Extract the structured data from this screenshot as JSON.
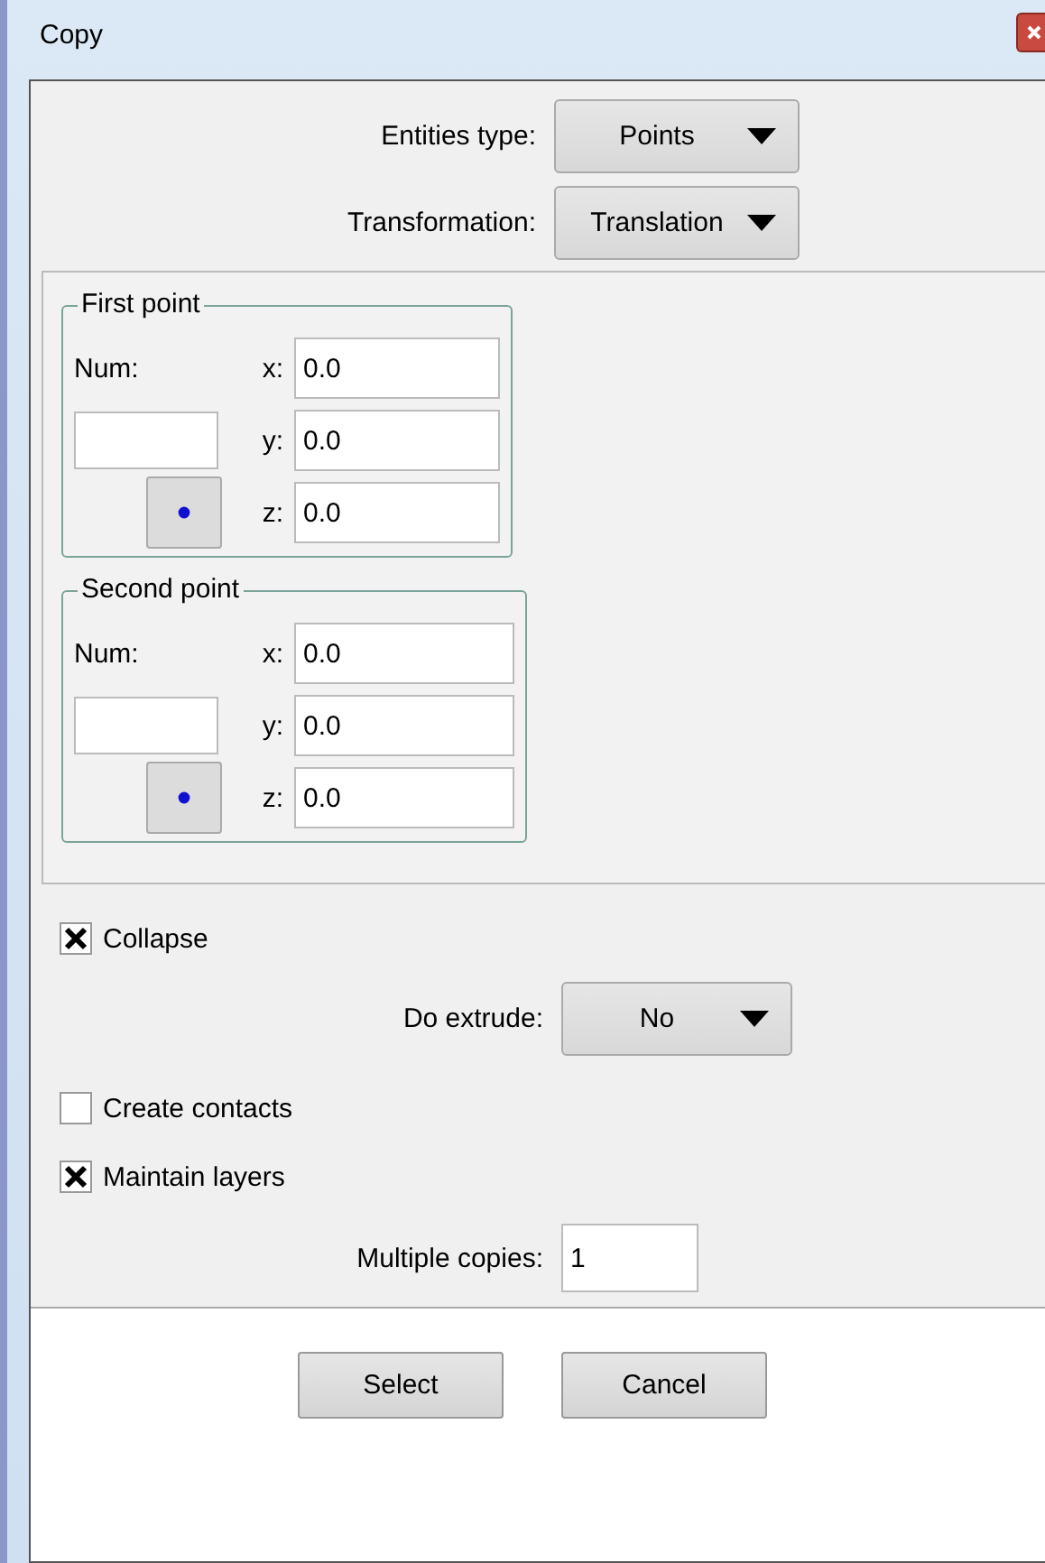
{
  "window": {
    "title": "Copy"
  },
  "top_fields": [
    {
      "label": "Entities type:",
      "value": "Points"
    },
    {
      "label": "Transformation:",
      "value": "Translation"
    }
  ],
  "point_groups": [
    {
      "title": "First point",
      "num_label": "Num:",
      "coords": [
        {
          "axis": "x:",
          "value": "0.0"
        },
        {
          "axis": "y:",
          "value": "0.0"
        },
        {
          "axis": "z:",
          "value": "0.0"
        }
      ]
    },
    {
      "title": "Second point",
      "num_label": "Num:",
      "coords": [
        {
          "axis": "x:",
          "value": "0.0"
        },
        {
          "axis": "y:",
          "value": "0.0"
        },
        {
          "axis": "z:",
          "value": "0.0"
        }
      ]
    }
  ],
  "options": [
    {
      "kind": "checkbox",
      "label": "Collapse",
      "checked": true
    },
    {
      "kind": "dropdown",
      "label": "Do extrude:",
      "value": "No"
    },
    {
      "kind": "checkbox",
      "label": "Create contacts",
      "checked": false
    },
    {
      "kind": "checkbox",
      "label": "Maintain layers",
      "checked": true
    },
    {
      "kind": "field",
      "label": "Multiple copies:",
      "value": "1"
    }
  ],
  "buttons": [
    "Select",
    "Cancel"
  ]
}
